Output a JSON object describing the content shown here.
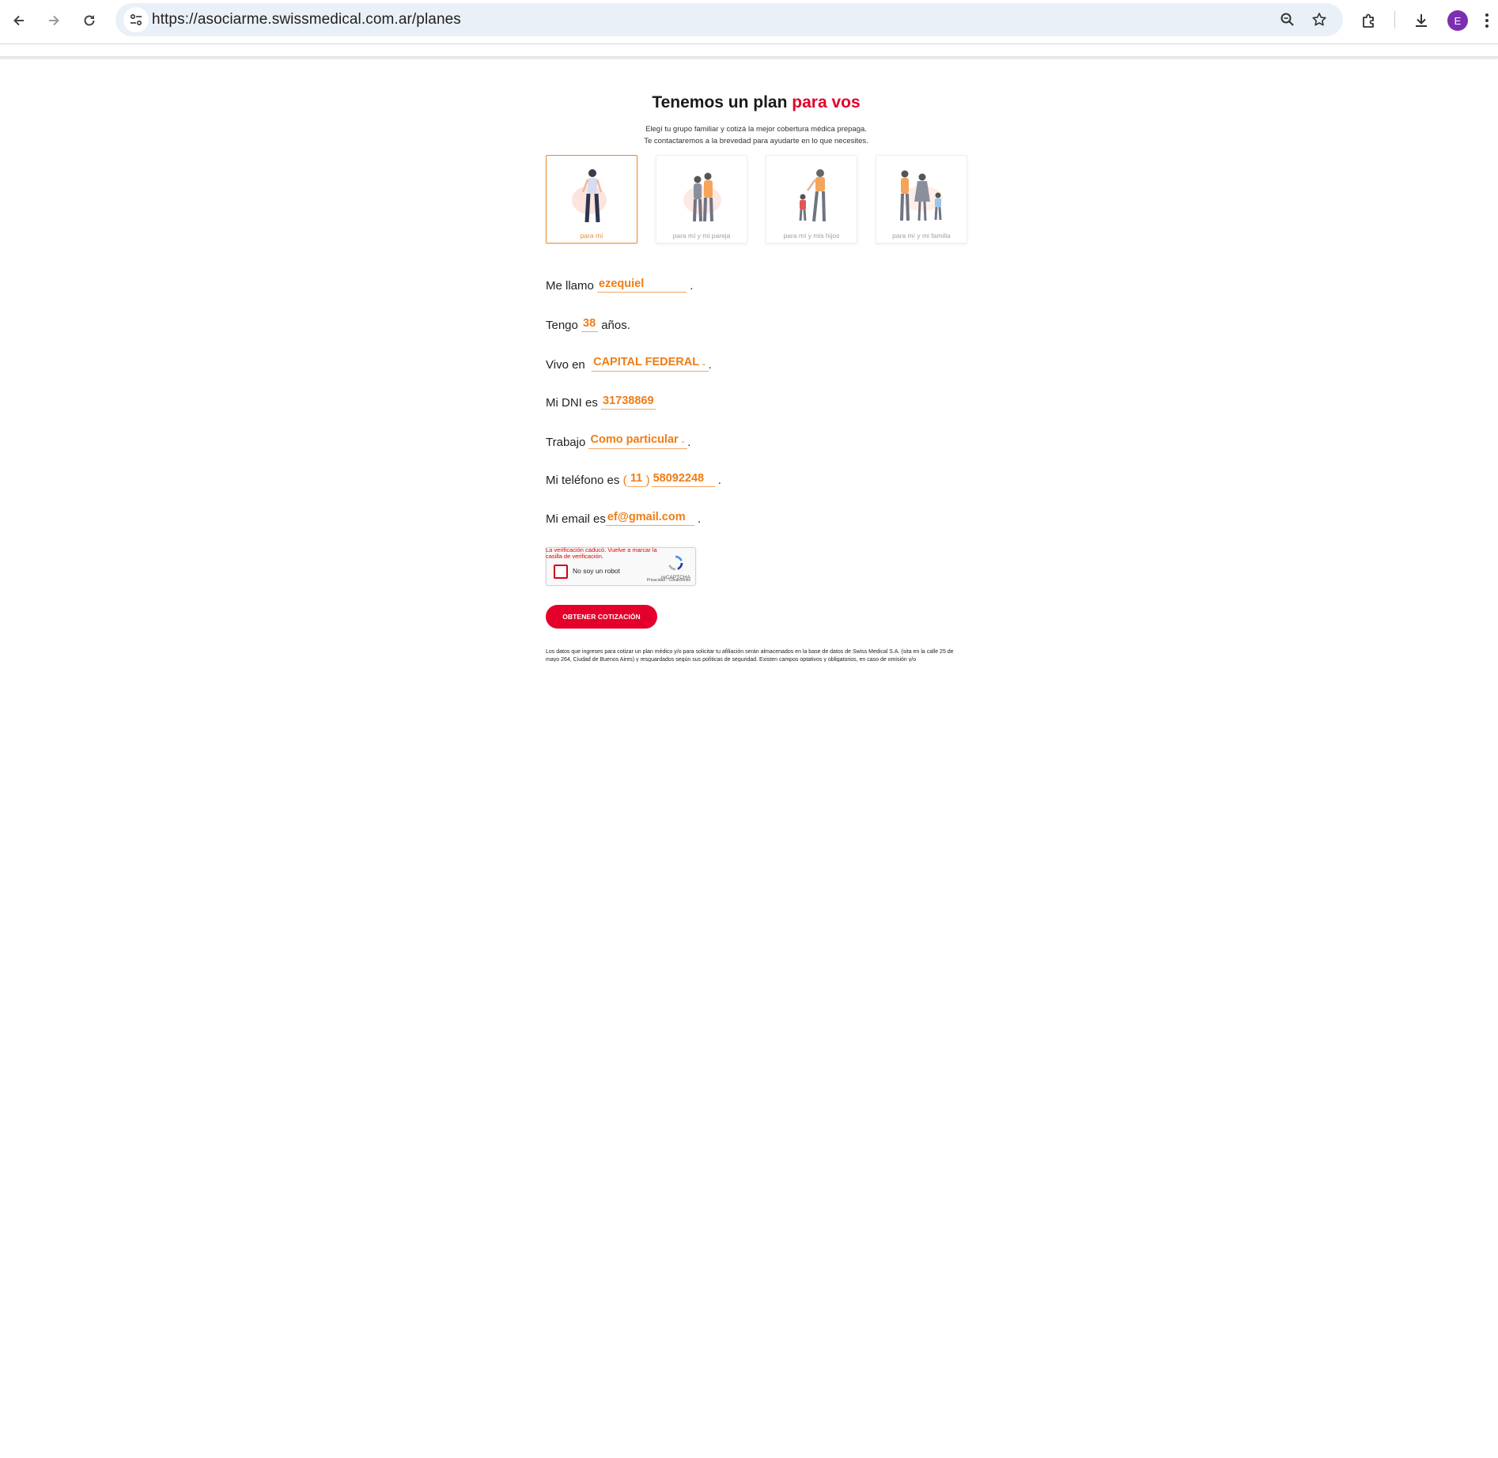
{
  "browser": {
    "url": "https://asociarme.swissmedical.com.ar/planes",
    "profile_initial": "E",
    "profile_color": "#7b2fb0"
  },
  "header": {
    "title_main": "Tenemos un plan",
    "title_accent": "para vos",
    "subtitle_line1": "Elegí tu grupo familiar y cotizá la mejor cobertura médica prepaga.",
    "subtitle_line2": "Te contactaremos a la brevedad para ayudarte en lo que necesites."
  },
  "plans": [
    {
      "label": "para mí",
      "selected": true,
      "icon": "single-person-illustration"
    },
    {
      "label": "para mí y mi pareja",
      "selected": false,
      "icon": "couple-illustration"
    },
    {
      "label": "para mí y mis hijos",
      "selected": false,
      "icon": "parent-with-child-illustration"
    },
    {
      "label": "para mí y mi familia",
      "selected": false,
      "icon": "family-illustration"
    }
  ],
  "form": {
    "name_prefix": "Me llamo",
    "name_value": "ezequiel",
    "name_suffix": ".",
    "age_prefix": "Tengo",
    "age_value": "38",
    "age_suffix": "años.",
    "location_prefix": "Vivo en",
    "location_value": "CAPITAL FEDERAL",
    "location_suffix": ".",
    "dni_prefix": "Mi DNI es",
    "dni_value": "31738869",
    "work_prefix": "Trabajo",
    "work_value": "Como particular",
    "work_suffix": ".",
    "phone_prefix": "Mi teléfono es",
    "phone_open": "(",
    "phone_area": "11",
    "phone_close": ")",
    "phone_number": "58092248",
    "phone_suffix": ".",
    "email_prefix": "Mi email es",
    "email_value": "ef@gmail.com",
    "email_suffix": "."
  },
  "captcha": {
    "error": "La verificación caducó. Vuelve a marcar la casilla de verificación.",
    "label": "No soy un robot",
    "brand": "reCAPTCHA",
    "links": "Privacidad - Condiciones"
  },
  "cta_label": "OBTENER COTIZACIÓN",
  "legal_text": "Los datos que ingreses para cotizar un plan médico y/o para solicitar tu afiliación serán almacenados en la base de datos de Swiss Medical S.A. (sita en la calle 25 de mayo 264, Ciudad de Buenos Aires) y resguardados según sus políticas de seguridad. Existen campos optativos y obligatorios, en caso de omisión y/o",
  "colors": {
    "accent_red": "#e4002b",
    "accent_orange": "#f07c14"
  }
}
